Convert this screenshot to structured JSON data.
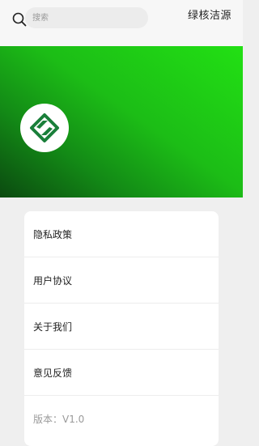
{
  "header": {
    "search_placeholder": "搜索",
    "brand": "绿核洁源"
  },
  "banner": {
    "colors": [
      "#0b4a10",
      "#1cbd16",
      "#22e014"
    ],
    "logo_icon": "green-diamond-logo-icon"
  },
  "menu": {
    "items": [
      {
        "label": "隐私政策"
      },
      {
        "label": "用户协议"
      },
      {
        "label": "关于我们"
      },
      {
        "label": "意见反馈"
      }
    ],
    "version_label": "版本：V1.0"
  },
  "icons": {
    "search": "search-icon"
  }
}
